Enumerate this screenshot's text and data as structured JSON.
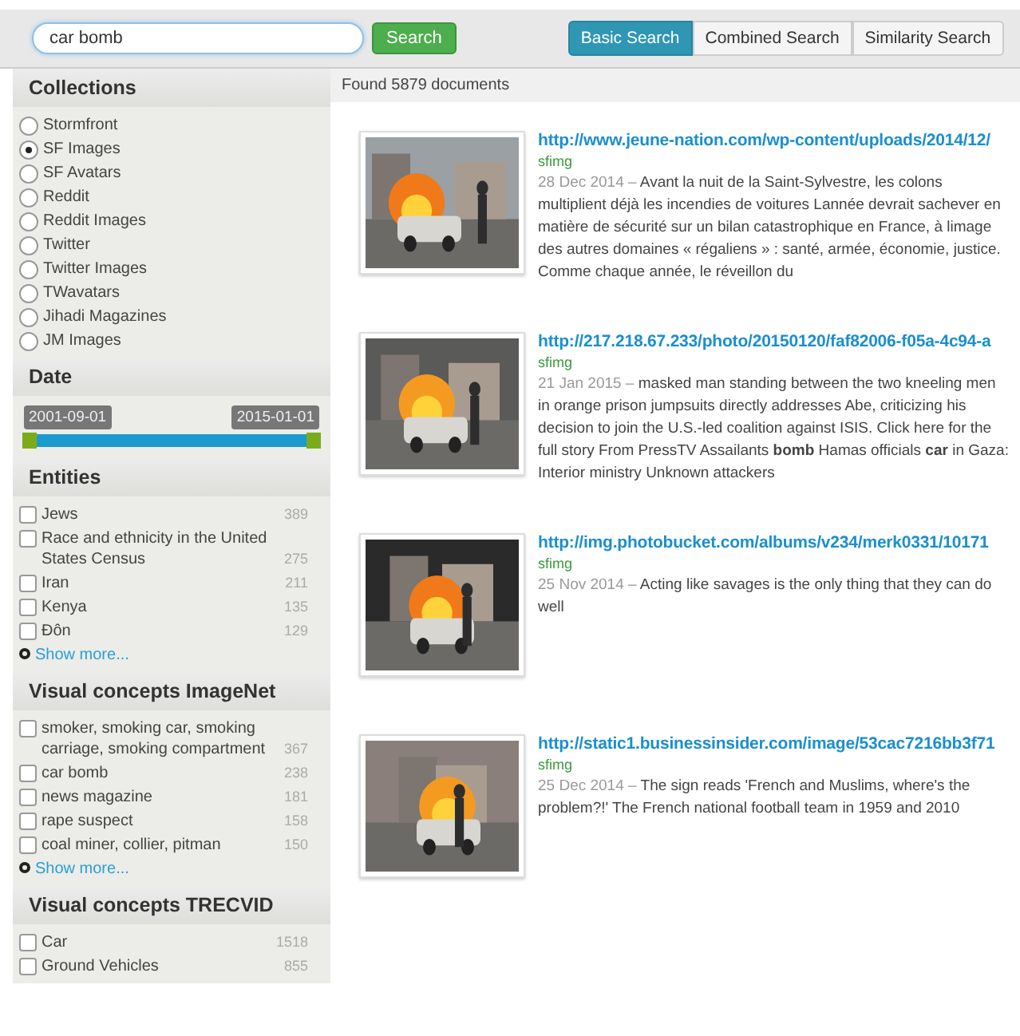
{
  "search": {
    "value": "car bomb",
    "button": "Search"
  },
  "modes": [
    {
      "label": "Basic Search",
      "selected": true
    },
    {
      "label": "Combined Search",
      "selected": false
    },
    {
      "label": "Similarity Search",
      "selected": false
    }
  ],
  "sidebar": {
    "collections": {
      "title": "Collections",
      "items": [
        {
          "label": "Stormfront",
          "selected": false
        },
        {
          "label": "SF Images",
          "selected": true
        },
        {
          "label": "SF Avatars",
          "selected": false
        },
        {
          "label": "Reddit",
          "selected": false
        },
        {
          "label": "Reddit Images",
          "selected": false
        },
        {
          "label": "Twitter",
          "selected": false
        },
        {
          "label": "Twitter Images",
          "selected": false
        },
        {
          "label": "TWavatars",
          "selected": false
        },
        {
          "label": "Jihadi Magazines",
          "selected": false
        },
        {
          "label": "JM Images",
          "selected": false
        }
      ]
    },
    "date": {
      "title": "Date",
      "start": "2001-09-01",
      "end": "2015-01-01",
      "handles": [
        {
          "level": 0
        },
        {
          "level": 1
        }
      ]
    },
    "facets": [
      {
        "title": "Entities",
        "more": "Show more...",
        "items": [
          {
            "label": "Jews",
            "count": "389",
            "checked": false
          },
          {
            "label": "Race and ethnicity in the United States Census",
            "count": "275",
            "checked": false
          },
          {
            "label": "Iran",
            "count": "211",
            "checked": false
          },
          {
            "label": "Kenya",
            "count": "135",
            "checked": false
          },
          {
            "label": "Đôn",
            "count": "129",
            "checked": false
          }
        ]
      },
      {
        "title": "Visual concepts ImageNet",
        "more": "Show more...",
        "items": [
          {
            "label": "smoker, smoking car, smoking carriage, smoking compartment",
            "count": "367",
            "checked": false
          },
          {
            "label": "car bomb",
            "count": "238",
            "checked": false
          },
          {
            "label": "news magazine",
            "count": "181",
            "checked": false
          },
          {
            "label": "rape suspect",
            "count": "158",
            "checked": false
          },
          {
            "label": "coal miner, collier, pitman",
            "count": "150",
            "checked": false
          }
        ]
      },
      {
        "title": "Visual concepts TRECVID",
        "items": [
          {
            "label": "Car",
            "count": "1518",
            "checked": false
          },
          {
            "label": "Ground Vehicles",
            "count": "855",
            "checked": false
          }
        ]
      }
    ]
  },
  "results": {
    "summary": "Found 5879 documents",
    "items": [
      {
        "url": "http://www.jeune-nation.com/wp-content/uploads/2014/12/",
        "source": "sfimg",
        "date": "28 Dec 2014 –",
        "snippet": "Avant la nuit de la Saint-Sylvestre, les colons multiplient déjà les incendies de voitures Lannée devrait sachever en matière de sécurité sur un bilan catastrophique en France, à limage des autres domaines « régaliens » : santé, armée, économie, justice. Comme chaque année, le réveillon du"
      },
      {
        "url": "http://217.218.67.233/photo/20150120/faf82006-f05a-4c94-a",
        "source": "sfimg",
        "date": "21 Jan 2015 –",
        "snippet": "masked man standing between the two kneeling men in orange prison jumpsuits directly addresses Abe, criticizing his decision to join the U.S.-led coalition against ISIS. Click here for the full story From PressTV Assailants **bomb** Hamas officials **car** in Gaza: Interior ministry Unknown attackers"
      },
      {
        "url": "http://img.photobucket.com/albums/v234/merk0331/10171",
        "source": "sfimg",
        "date": "25 Nov 2014 –",
        "snippet": "Acting like savages is the only thing that they can do well"
      },
      {
        "url": "http://static1.businessinsider.com/image/53cac7216bb3f71",
        "source": "sfimg",
        "date": "25 Dec 2014 –",
        "snippet": "The sign reads 'French and Muslims, where's the problem?!' The French national football team in 1959 and 2010"
      }
    ]
  }
}
